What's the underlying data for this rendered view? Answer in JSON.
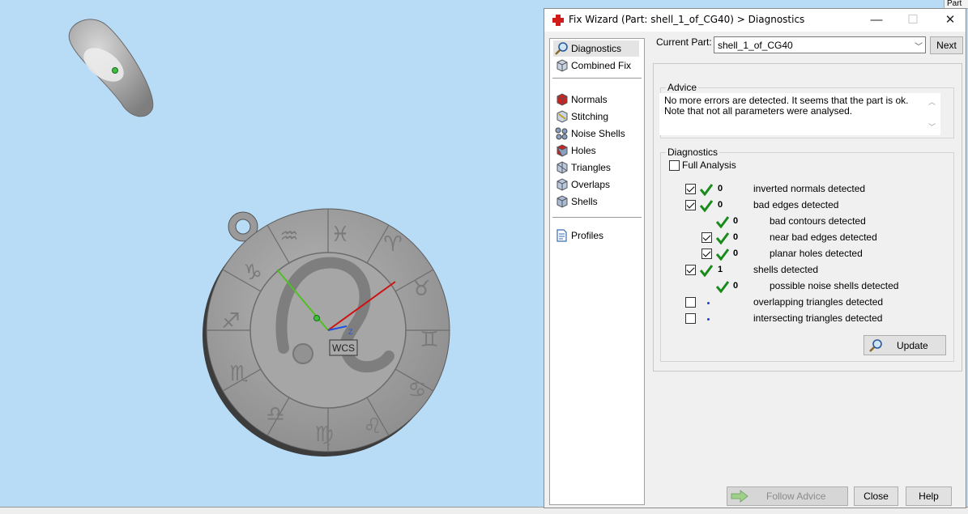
{
  "dialog": {
    "title": "Fix Wizard (Part: shell_1_of_CG40) > Diagnostics",
    "controls": {
      "minimize": "—",
      "maximize": "☐",
      "close": "✕"
    }
  },
  "nav": {
    "items": [
      {
        "label": "Diagnostics",
        "icon": "magnifier-icon",
        "selected": true
      },
      {
        "label": "Combined Fix",
        "icon": "cube-icon"
      },
      {
        "label": "Normals",
        "icon": "red-cube-icon"
      },
      {
        "label": "Stitching",
        "icon": "stitching-icon"
      },
      {
        "label": "Noise Shells",
        "icon": "noise-shells-icon"
      },
      {
        "label": "Holes",
        "icon": "holes-icon"
      },
      {
        "label": "Triangles",
        "icon": "triangles-icon"
      },
      {
        "label": "Overlaps",
        "icon": "overlaps-icon"
      },
      {
        "label": "Shells",
        "icon": "shells-icon"
      },
      {
        "label": "Profiles",
        "icon": "document-icon"
      }
    ]
  },
  "current_part": {
    "label": "Current Part:",
    "value": "shell_1_of_CG40",
    "next_label": "Next"
  },
  "advice": {
    "title": "Advice",
    "text": "No more errors are detected. It seems that the part is ok. Note that not all parameters were analysed."
  },
  "diagnostics": {
    "title": "Diagnostics",
    "full_analysis_label": "Full Analysis",
    "full_analysis_checked": false,
    "rows": [
      {
        "checkbox": true,
        "checked": true,
        "status": "ok",
        "count": "0",
        "label": "inverted normals detected",
        "indent": 0
      },
      {
        "checkbox": true,
        "checked": true,
        "status": "ok",
        "count": "0",
        "label": "bad edges detected",
        "indent": 0
      },
      {
        "checkbox": false,
        "checked": false,
        "status": "ok",
        "count": "0",
        "label": "bad contours detected",
        "indent": 1
      },
      {
        "checkbox": true,
        "checked": true,
        "status": "ok",
        "count": "0",
        "label": "near bad edges detected",
        "indent": 1
      },
      {
        "checkbox": true,
        "checked": true,
        "status": "ok",
        "count": "0",
        "label": "planar holes detected",
        "indent": 1
      },
      {
        "checkbox": true,
        "checked": true,
        "status": "ok",
        "count": "1",
        "label": "shells detected",
        "indent": 0
      },
      {
        "checkbox": false,
        "checked": false,
        "status": "ok",
        "count": "0",
        "label": "possible noise shells detected",
        "indent": 1
      },
      {
        "checkbox": true,
        "checked": false,
        "status": "pending",
        "count": "",
        "label": "overlapping triangles detected",
        "indent": 0
      },
      {
        "checkbox": true,
        "checked": false,
        "status": "pending",
        "count": "",
        "label": "intersecting triangles detected",
        "indent": 0
      }
    ],
    "update_label": "Update"
  },
  "footer": {
    "follow_advice_label": "Follow Advice",
    "close_label": "Close",
    "help_label": "Help"
  },
  "viewport": {
    "wcs_label": "WCS",
    "axis_z_label": "Z"
  },
  "corner_tab": "Part",
  "colors": {
    "viewport_bg": "#b9dcf6",
    "dialog_bg": "#f0f0f0",
    "check_green": "#1a8a1a",
    "axis_red": "#d01010",
    "axis_green": "#50c020",
    "axis_blue": "#2050e0"
  }
}
